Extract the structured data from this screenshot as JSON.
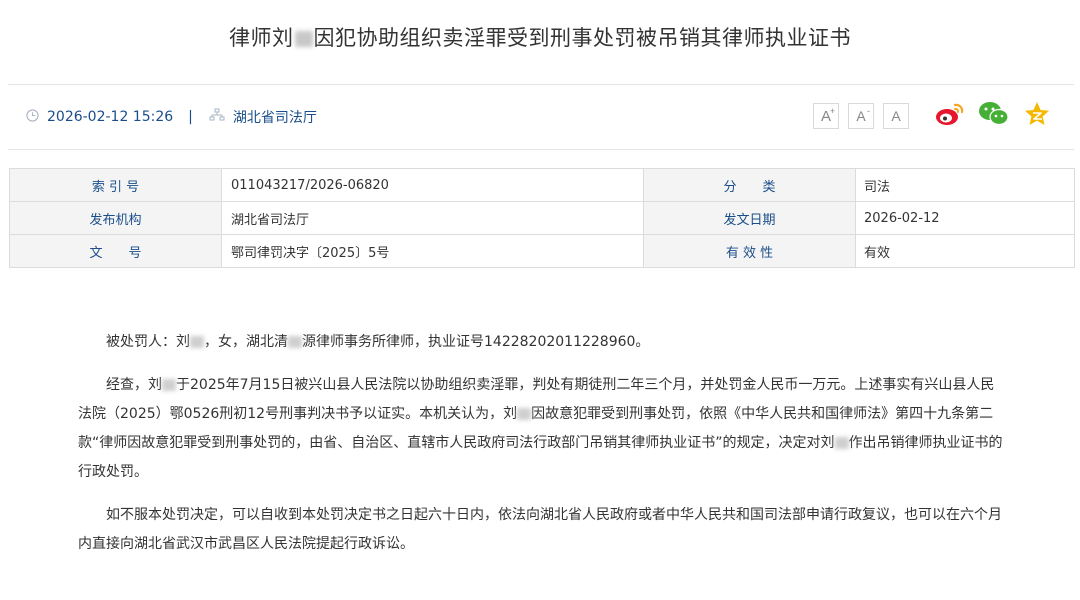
{
  "article": {
    "title_part1": "律师刘",
    "title_part2": "因犯协助组织卖淫罪受到刑事处罚被吊销其律师执业证书",
    "date": "2026-02-12 15:26",
    "separator": "|",
    "source": "湖北省司法厅"
  },
  "toolbar": {
    "font_large": "A",
    "font_large_sup": "+",
    "font_small": "A",
    "font_small_sup": "-",
    "font_reset": "A"
  },
  "share_icons": [
    "weibo-icon",
    "wechat-icon",
    "qzone-icon"
  ],
  "info_table": {
    "rows": [
      {
        "k1": "索 引 号",
        "v1": "011043217/2026-06820",
        "k2": "分　　类",
        "v2": "司法"
      },
      {
        "k1": "发布机构",
        "v1": "湖北省司法厅",
        "k2": "发文日期",
        "v2": "2026-02-12"
      },
      {
        "k1": "文　　号",
        "v1": "鄂司律罚决字〔2025〕5号",
        "k2": "有 效 性",
        "v2": "有效"
      }
    ]
  },
  "content": {
    "p1_a": "被处罚人：刘",
    "p1_b": "，女，湖北清",
    "p1_c": "源律师事务所律师，执业证号14228202011228960。",
    "p2_a": "经查，刘",
    "p2_b": "于2025年7月15日被兴山县人民法院以协助组织卖淫罪，判处有期徒刑二年三个月，并处罚金人民币一万元。上述事实有兴山县人民法院（2025）鄂0526刑初12号刑事判决书予以证实。本机关认为，刘",
    "p2_c": "因故意犯罪受到刑事处罚，依照《中华人民共和国律师法》第四十九条第二款“律师因故意犯罪受到刑事处罚的，由省、自治区、直辖市人民政府司法行政部门吊销其律师执业证书”的规定，决定对刘",
    "p2_d": "作出吊销律师执业证书的行政处罚。",
    "p3": "如不服本处罚决定，可以自收到本处罚决定书之日起六十日内，依法向湖北省人民政府或者中华人民共和国司法部申请行政复议，也可以在六个月内直接向湖北省武汉市武昌区人民法院提起行政诉讼。"
  },
  "colors": {
    "link_blue": "#1a4e8a",
    "weibo": "#e6162d",
    "wechat": "#45b035",
    "qzone": "#f5b800"
  }
}
